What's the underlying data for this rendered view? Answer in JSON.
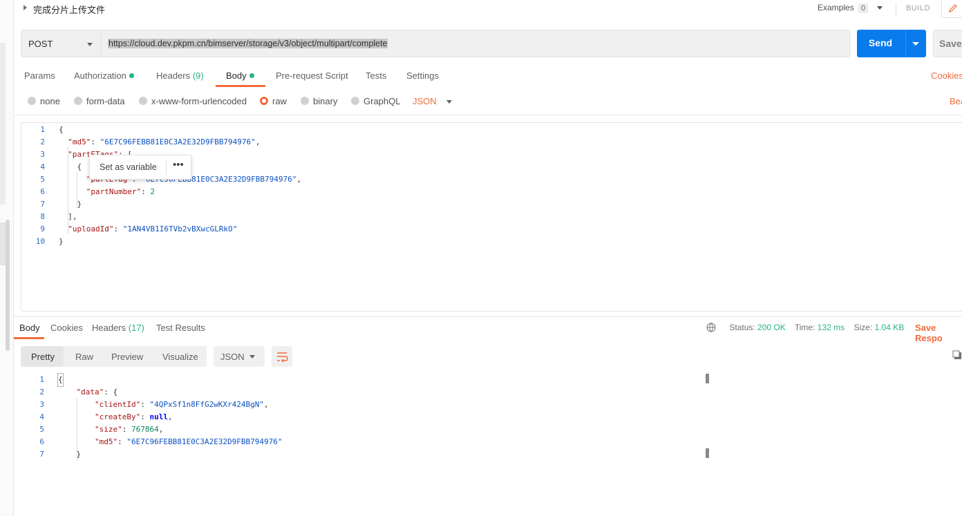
{
  "request": {
    "name": "完成分片上传文件",
    "examples_label": "Examples",
    "examples_count": "0",
    "build_label": "BUILD",
    "method": "POST",
    "url": "https://cloud.dev.pkpm.cn/bimserver/storage/v3/object/multipart/complete",
    "send_label": "Send",
    "save_label": "Save"
  },
  "request_tabs": [
    {
      "label": "Params"
    },
    {
      "label": "Authorization"
    },
    {
      "label": "Headers",
      "count": "(9)"
    },
    {
      "label": "Body"
    },
    {
      "label": "Pre-request Script"
    },
    {
      "label": "Tests"
    },
    {
      "label": "Settings"
    }
  ],
  "cookies_label": "Cookies",
  "body_types": [
    "none",
    "form-data",
    "x-www-form-urlencoded",
    "raw",
    "binary",
    "GraphQL"
  ],
  "body_selected": "raw",
  "body_format": "JSON",
  "beautify_label": "Bea",
  "request_body": {
    "md5": "6E7C96FEBB81E0C3A2E32D9FBB794976",
    "partETags_key": "partETags",
    "part_tag_value_visible": "6E7C96FEBB81E0C3A2E32D9FBB794976",
    "partNumber": "2",
    "uploadId": "1AN4VB1I6TVb2vBXwcGLRkO"
  },
  "popup": {
    "label": "Set as variable",
    "more": "•••"
  },
  "response_tabs": [
    {
      "label": "Body"
    },
    {
      "label": "Cookies"
    },
    {
      "label": "Headers",
      "count": "(17)"
    },
    {
      "label": "Test Results"
    }
  ],
  "status": {
    "status_label": "Status:",
    "status_value": "200 OK",
    "time_label": "Time:",
    "time_value": "132 ms",
    "size_label": "Size:",
    "size_value": "1.04 KB",
    "save_response": "Save Respo"
  },
  "view_modes": [
    "Pretty",
    "Raw",
    "Preview",
    "Visualize"
  ],
  "view_selected": "Pretty",
  "response_format": "JSON",
  "response_body": {
    "clientId": "4QPxSf1n8FfG2wKXr424BgN",
    "createBy": "null",
    "size": "767864",
    "md5": "6E7C96FEBB81E0C3A2E32D9FBB794976"
  },
  "colors": {
    "accent": "#f26b3a",
    "send": "#097bed",
    "success": "#26b47f"
  }
}
